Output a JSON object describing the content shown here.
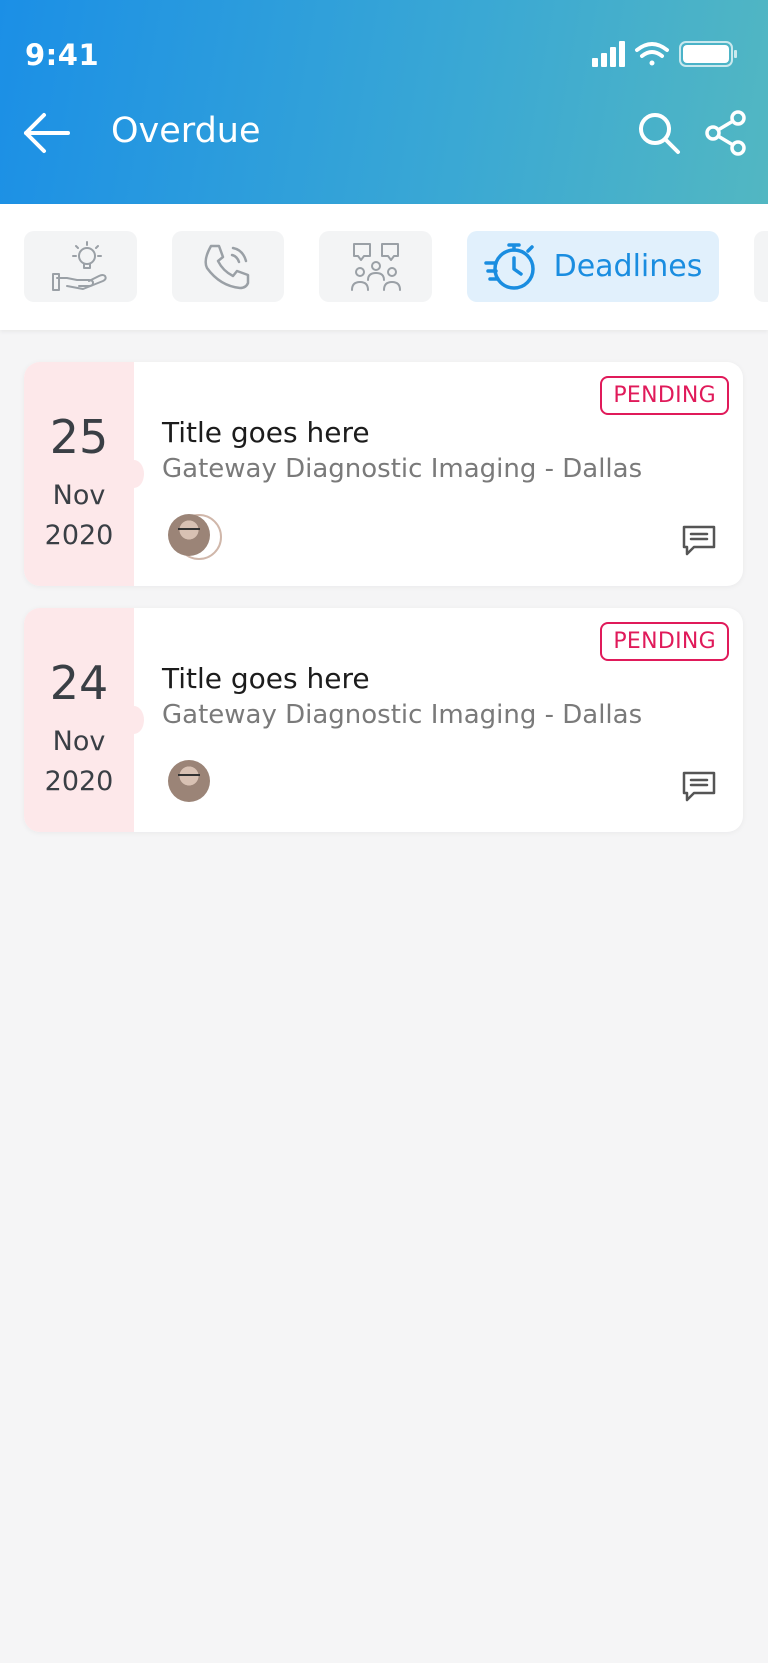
{
  "status_bar": {
    "time": "9:41"
  },
  "header": {
    "title": "Overdue",
    "back_icon": "arrow-left-icon",
    "search_icon": "search-icon",
    "share_icon": "share-icon"
  },
  "tabs": [
    {
      "icon": "idea-hand-icon",
      "label": "",
      "active": false
    },
    {
      "icon": "phone-call-icon",
      "label": "",
      "active": false
    },
    {
      "icon": "group-meeting-icon",
      "label": "",
      "active": false
    },
    {
      "icon": "stopwatch-icon",
      "label": "Deadlines",
      "active": true
    }
  ],
  "colors": {
    "header_gradient_start": "#1b8fe6",
    "header_gradient_end": "#52b7c2",
    "accent": "#1a8de0",
    "pending": "#e01a5a",
    "date_bg": "#fde8ea"
  },
  "items": [
    {
      "day": "25",
      "month": "Nov",
      "year": "2020",
      "status": "PENDING",
      "title": "Title goes here",
      "subtitle": "Gateway Diagnostic Imaging - Dallas"
    },
    {
      "day": "24",
      "month": "Nov",
      "year": "2020",
      "status": "PENDING",
      "title": "Title goes here",
      "subtitle": "Gateway Diagnostic Imaging - Dallas"
    }
  ]
}
